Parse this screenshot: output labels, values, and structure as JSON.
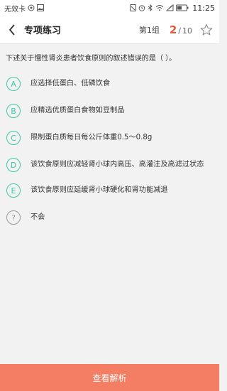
{
  "status_bar": {
    "carrier": "无效卡",
    "time": "11:25",
    "icons": [
      "sim-no-service-icon",
      "message-icon",
      "image-icon",
      "alarm-icon",
      "bluetooth-icon",
      "wifi-icon",
      "signal-icon",
      "battery-icon"
    ]
  },
  "header": {
    "title": "专项练习",
    "group": "第1组",
    "progress_current": "2",
    "progress_separator": "/",
    "progress_total": "10"
  },
  "question": {
    "text": "下述关于慢性肾炎患者饮食原则的叙述错误的是（        ）。"
  },
  "options": [
    {
      "badge": "A",
      "text": "应选择低蛋白、低磷饮食"
    },
    {
      "badge": "B",
      "text": "应精选优质蛋白食物如豆制品"
    },
    {
      "badge": "C",
      "text": "限制蛋白质每日每公斤体重0.5～0.8g"
    },
    {
      "badge": "D",
      "text": "该饮食原则应减轻肾小球内高压、高灌注及高滤过状态"
    },
    {
      "badge": "E",
      "text": "该饮食原则应延缓肾小球硬化和肾功能减退"
    },
    {
      "badge": "?",
      "text": "不会"
    }
  ],
  "footer": {
    "button_label": "查看解析"
  },
  "colors": {
    "accent_green": "#3cc8a6",
    "progress_red": "#e8583a",
    "button_bg": "#f47e63"
  }
}
